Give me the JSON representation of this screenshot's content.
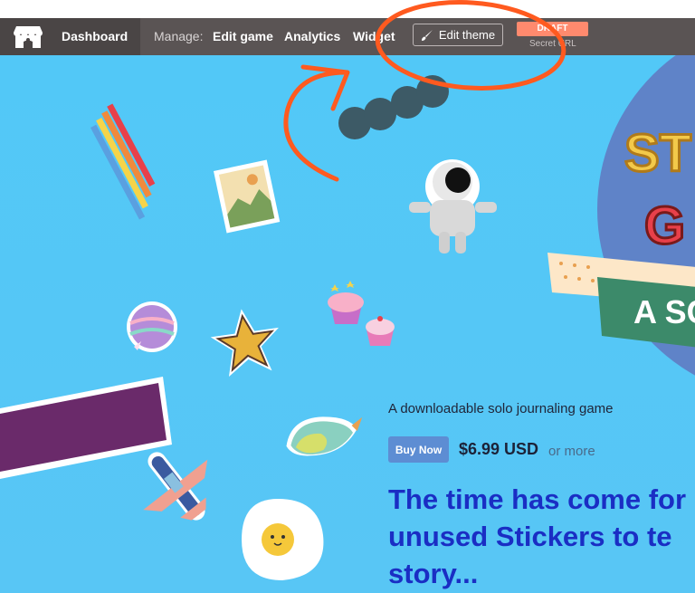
{
  "navbar": {
    "home_label": "Dashboard",
    "manage_label": "Manage:",
    "links": [
      "Edit game",
      "Analytics",
      "Widget"
    ],
    "edit_theme_label": "Edit theme",
    "draft_label": "DRAFT",
    "secret_url_label": "Secret URL"
  },
  "hero": {
    "title_fragments": [
      "ST",
      "G",
      "A SC"
    ]
  },
  "game": {
    "tagline": "A downloadable solo journaling game",
    "buy_label": "Buy Now",
    "price": "$6.99 USD",
    "price_suffix": "or more",
    "headline": "The time has come for\nunused Stickers to te\nstory..."
  },
  "colors": {
    "navbar": "#5a5454",
    "background": "#52c8f7",
    "draft_badge": "#ff8a6e",
    "buy_button": "#5d8dd3",
    "headline": "#1a2ec4",
    "annotation": "#ff5a1f"
  },
  "icons": {
    "logo": "itchio-logo",
    "brush": "brush-icon"
  }
}
